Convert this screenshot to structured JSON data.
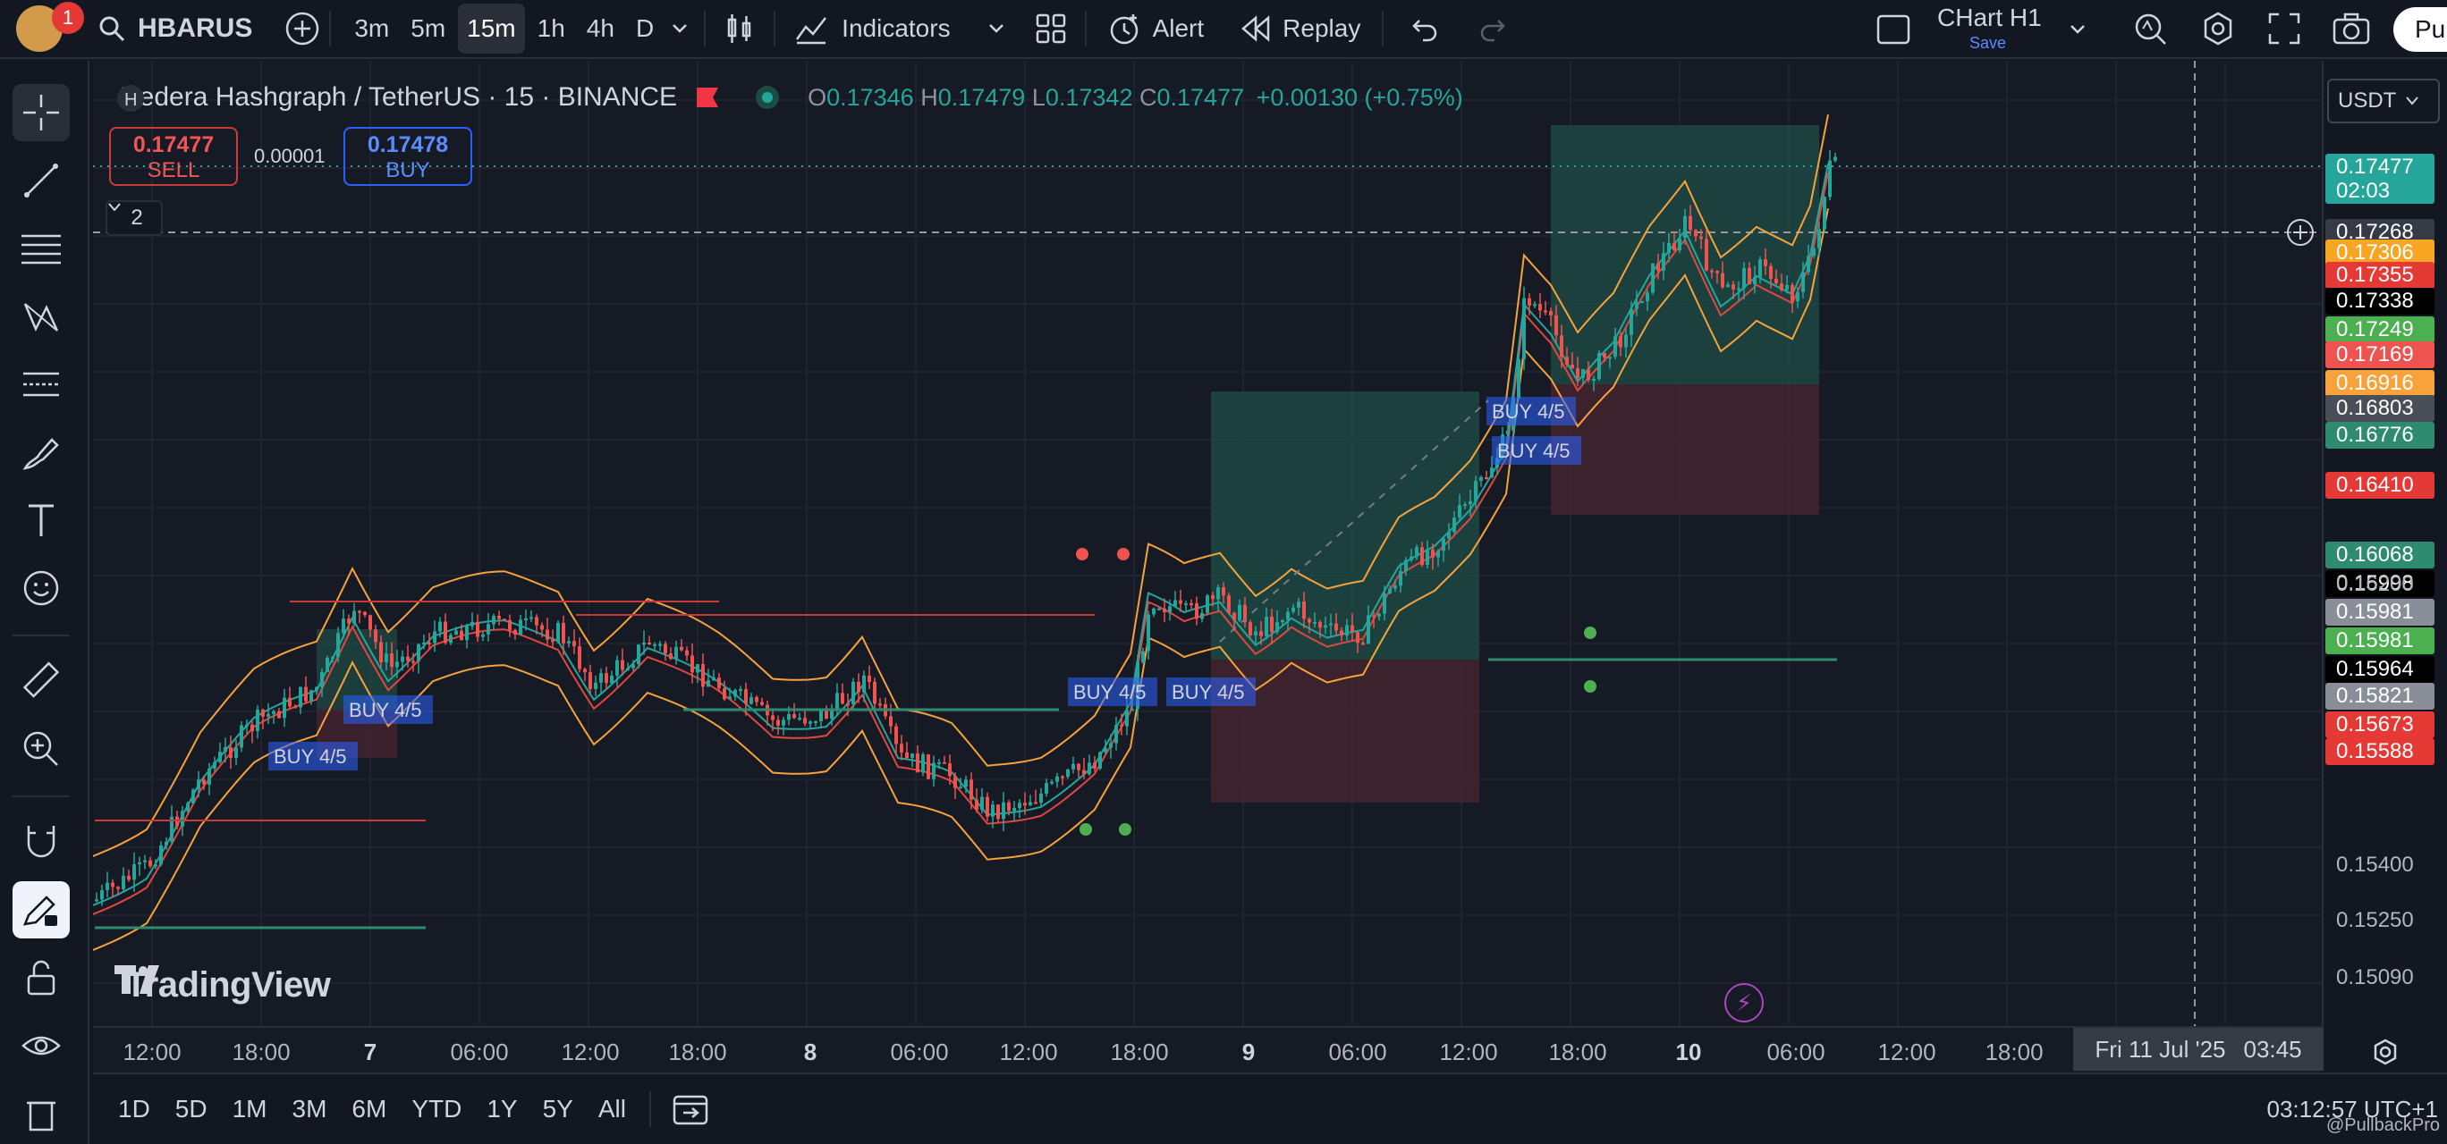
{
  "topbar": {
    "notification_count": "1",
    "symbol": "HBARUS",
    "timeframes": [
      "3m",
      "5m",
      "15m",
      "1h",
      "4h",
      "D"
    ],
    "active_timeframe": "15m",
    "indicators_label": "Indicators",
    "alert_label": "Alert",
    "replay_label": "Replay",
    "layout_name": "CHart H1",
    "save_label": "Save",
    "pro_label": "Pu"
  },
  "legend": {
    "title": "Hedera Hashgraph / TetherUS · 15 · BINANCE",
    "ohlc": {
      "o": "0.17346",
      "h": "0.17479",
      "l": "0.17342",
      "c": "0.17477",
      "change": "+0.00130 (+0.75%)"
    },
    "o_label": "O",
    "h_label": "H",
    "l_label": "L",
    "c_label": "C"
  },
  "trade": {
    "sell_price": "0.17477",
    "sell_label": "SELL",
    "spread": "0.00001",
    "buy_price": "0.17478",
    "buy_label": "BUY"
  },
  "collapse_count": "2",
  "watermark": "TradingView",
  "price_scale": {
    "currency": "USDT",
    "labels": [
      {
        "value": "0.17477",
        "sub": "02:03",
        "color": "#26a69a"
      },
      {
        "value": "0.17268",
        "color": "#363a45"
      },
      {
        "value": "0.17306",
        "color": "#f6a623"
      },
      {
        "value": "0.17355",
        "color": "#e53935"
      },
      {
        "value": "0.17338",
        "color": "#000000"
      },
      {
        "value": "0.17249",
        "color": "#4caf50"
      },
      {
        "value": "0.17169",
        "color": "#ef5350"
      },
      {
        "value": "0.16916",
        "color": "#f7a23a"
      },
      {
        "value": "0.16803",
        "color": "#4a4e59"
      },
      {
        "value": "0.16776",
        "color": "#2e8b6e"
      },
      {
        "value": "0.16410",
        "color": "#e53935"
      },
      {
        "value": "0.16068",
        "color": "#2e8b6e"
      },
      {
        "value": "0.15998",
        "color": "#000000"
      },
      {
        "value": "0.15981",
        "color": "#8a8e99"
      },
      {
        "value": "0.15981",
        "color": "#4caf50"
      },
      {
        "value": "0.15964",
        "color": "#000000"
      },
      {
        "value": "0.15821",
        "color": "#8a8e99"
      },
      {
        "value": "0.15673",
        "color": "#e53935"
      },
      {
        "value": "0.15588",
        "color": "#e53935"
      }
    ],
    "ticks": [
      "0.16200",
      "0.15400",
      "0.15250",
      "0.15090"
    ]
  },
  "time_axis": {
    "labels": [
      "12:00",
      "18:00",
      "7",
      "06:00",
      "12:00",
      "18:00",
      "8",
      "06:00",
      "12:00",
      "18:00",
      "9",
      "06:00",
      "12:00",
      "18:00",
      "10",
      "06:00",
      "12:00",
      "18:00"
    ],
    "crosshair_date": "Fri 11 Jul '25",
    "crosshair_time": "03:45"
  },
  "signals": [
    "BUY 4/5",
    "BUY 4/5",
    "BUY 4/5",
    "BUY 4/5",
    "BUY 4/5",
    "BUY 4/5"
  ],
  "ranges": [
    "1D",
    "5D",
    "1M",
    "3M",
    "6M",
    "YTD",
    "1Y",
    "5Y",
    "All"
  ],
  "clock": "03:12:57 UTC+1",
  "credit": "@PullbackPro",
  "colors": {
    "up": "#26a69a",
    "down": "#ef5350",
    "band": "#f7a23a",
    "bg": "#161a25"
  }
}
